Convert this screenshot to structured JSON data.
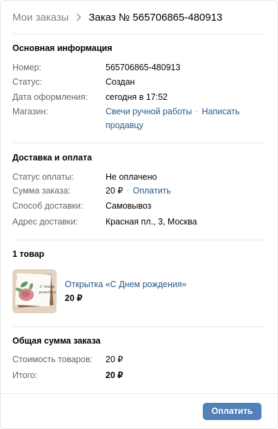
{
  "header": {
    "breadcrumb_link": "Мои заказы",
    "breadcrumb_current": "Заказ № 565706865-480913"
  },
  "main_info": {
    "title": "Основная информация",
    "number_label": "Номер:",
    "number_value": "565706865-480913",
    "status_label": "Статус:",
    "status_value": "Создан",
    "date_label": "Дата оформления:",
    "date_value": "сегодня в 17:52",
    "shop_label": "Магазин:",
    "shop_name": "Свечи ручной работы",
    "shop_dot": "·",
    "write_seller": "Написать продавцу"
  },
  "delivery": {
    "title": "Доставка и оплата",
    "pay_status_label": "Статус оплаты:",
    "pay_status_value": "Не оплачено",
    "sum_label": "Сумма заказа:",
    "sum_value": "20 ₽",
    "sum_dot": "·",
    "pay_link": "Оплатить",
    "method_label": "Способ доставки:",
    "method_value": "Самовывоз",
    "address_label": "Адрес доставки:",
    "address_value": "Красная пл., 3, Москва"
  },
  "items": {
    "title": "1 товар",
    "products": [
      {
        "name": "Открытка «С Днем рождения»",
        "price": "20 ₽",
        "image_text": "С днём рождения"
      }
    ]
  },
  "total": {
    "title": "Общая сумма заказа",
    "goods_label": "Стоимость товаров:",
    "goods_value": "20 ₽",
    "total_label": "Итого:",
    "total_value": "20 ₽"
  },
  "footer": {
    "pay_button": "Оплатить"
  },
  "colors": {
    "link": "#2a5885",
    "button": "#5181b8",
    "label": "#656565",
    "divider": "#e7e8ec"
  },
  "icons": {
    "breadcrumb_separator": "chevron-right-icon"
  }
}
